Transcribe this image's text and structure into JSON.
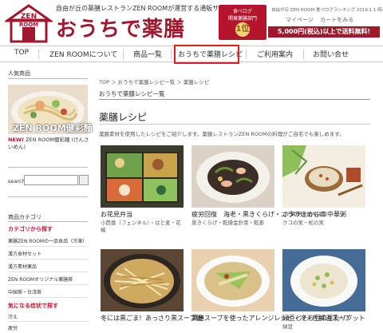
{
  "header": {
    "tagline": "自由が丘の薬膳レストランZEN ROOMが運営する通販サイト",
    "brand": "おうちで薬膳",
    "logo_text": "ZEN ROOM",
    "rank_badge": {
      "line1": "食べログ",
      "line2": "関東薬膳部門",
      "rank": "1位"
    },
    "top_right_note": "自由が丘 ZEN ROOM 食べログランキング 2019.1.1 時点",
    "util_links": [
      "マイページ",
      "カートをみる"
    ],
    "shipping_banner": "5,000円(税込)以上で送料無料!"
  },
  "nav": {
    "items": [
      "TOP",
      "ZEN ROOMについて",
      "商品一覧",
      "おうちで薬膳レシピ",
      "ご利用案内",
      "お問い合せ"
    ]
  },
  "sidebar": {
    "popular_title": "人気商品",
    "product_caption": "ZEN ROOM健彩麺",
    "new_label": "NEW!",
    "new_text": " ZEN ROOM健彩麺 (けんさいめん)",
    "search_label": "search",
    "search_value": "",
    "categories_title": "商品カテゴリ",
    "categories_head": "カテゴリから探す",
    "categories": [
      "薬膳ZEN ROOMの一品食品（冷凍）",
      "漢方食材セット",
      "漢方素材薬品",
      "ZEN ROOMオリジナル薬膳茶",
      "中国茶・台湾茶"
    ],
    "symptoms_head": "気になる症状で探す",
    "symptoms": [
      "冷え",
      "疲労"
    ]
  },
  "main": {
    "breadcrumb": "TOP ＞ おうちで薬膳レシピ一覧 ＞ 薬膳レシピ",
    "page_title": "おうちで薬膳レシピ一覧",
    "section_title": "薬膳レシピ",
    "intro": "薬膳素材を使用したレシピをご紹介します。薬膳レストランZEN ROOMの料理がご自宅でも楽しめます。",
    "recipes": [
      {
        "title": "お花見弁当",
        "sub": "小茴香（フェンネル）・はと麦・花椒"
      },
      {
        "title": "疲労回復　海老・黒きくらげ・ニラの炒めもの",
        "sub": "黒きくらげ・乾燥金針菜・乾姜"
      },
      {
        "title": "ホタテとかぶの中華粥",
        "sub": "クコの実・松の実"
      },
      {
        "title": "冬には黒ごま！あっさり黒スープ鍋",
        "sub": ""
      },
      {
        "title": "薬膳スープを使ったアレンジレシピ・冷え性解消スープ",
        "sub": ""
      },
      {
        "title": "緑豆とそら豆の豆乳リゾット",
        "sub": "緑豆"
      }
    ]
  },
  "colors": {
    "brand": "#a0182e",
    "active_box": "#e01c1c"
  }
}
